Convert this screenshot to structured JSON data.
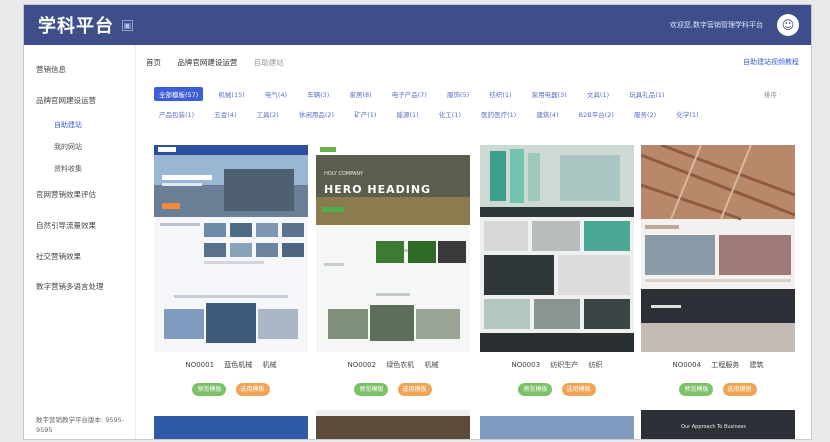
{
  "header": {
    "brand": "学科平台",
    "collapse_icon": "▣",
    "user_text": "欢迎您,数字营销管理学科平台",
    "avatar_glyph": "☺"
  },
  "sidebar": {
    "items": [
      {
        "label": "营销信息"
      },
      {
        "label": "品牌官网建设运营"
      },
      {
        "label": "官网营销效果评估"
      },
      {
        "label": "自然引导流量效果"
      },
      {
        "label": "社交营销效果"
      },
      {
        "label": "数字营销多语言处理"
      }
    ],
    "subitems": [
      {
        "label": "自助建站"
      },
      {
        "label": "我的网站"
      },
      {
        "label": "资料收集"
      }
    ],
    "footer": "数字营销教学平台版本: 9595-9595"
  },
  "tabs": [
    {
      "label": "首页"
    },
    {
      "label": "品牌官网建设运营"
    },
    {
      "label": "自助建站"
    }
  ],
  "help_link": "自助建站视频教程",
  "filters": {
    "row1": [
      "全部模板(57)",
      "机械(15)",
      "电气(4)",
      "车辆(3)",
      "家居(8)",
      "电子产品(7)",
      "服饰(5)",
      "纺织(1)",
      "家用电器(3)",
      "文具(1)",
      "玩具礼品(1)"
    ],
    "row2": [
      "产品包装(1)",
      "五金(4)",
      "工具(2)",
      "休闲用品(2)",
      "矿产(1)",
      "能源(1)",
      "化工(1)",
      "医药医疗(1)",
      "建筑(4)",
      "B2B平台(2)",
      "服务(2)",
      "化学(1)"
    ],
    "sort_label": "排序 ·"
  },
  "cards": [
    {
      "code": "NO0001",
      "name": "蓝色机械",
      "category": "机械",
      "preview": "预览模板",
      "use": "选用模板"
    },
    {
      "code": "NO0002",
      "name": "绿色农机",
      "category": "机械",
      "preview": "预览模板",
      "use": "选用模板",
      "hero_text": "HERO HEADING",
      "label_small": "HOLY COMPANY"
    },
    {
      "code": "NO0003",
      "name": "纺织生产",
      "category": "纺织",
      "preview": "预览模板",
      "use": "选用模板"
    },
    {
      "code": "NO0004",
      "name": "工程服务",
      "category": "建筑",
      "preview": "预览模板",
      "use": "选用模板"
    }
  ],
  "bottom_peek": {
    "card4_text": "Our Approach To Business"
  },
  "colors": {
    "topbar": "#3d4e8a",
    "accent": "#3d5fd6",
    "green": "#7cc06a",
    "orange": "#f0a456"
  }
}
